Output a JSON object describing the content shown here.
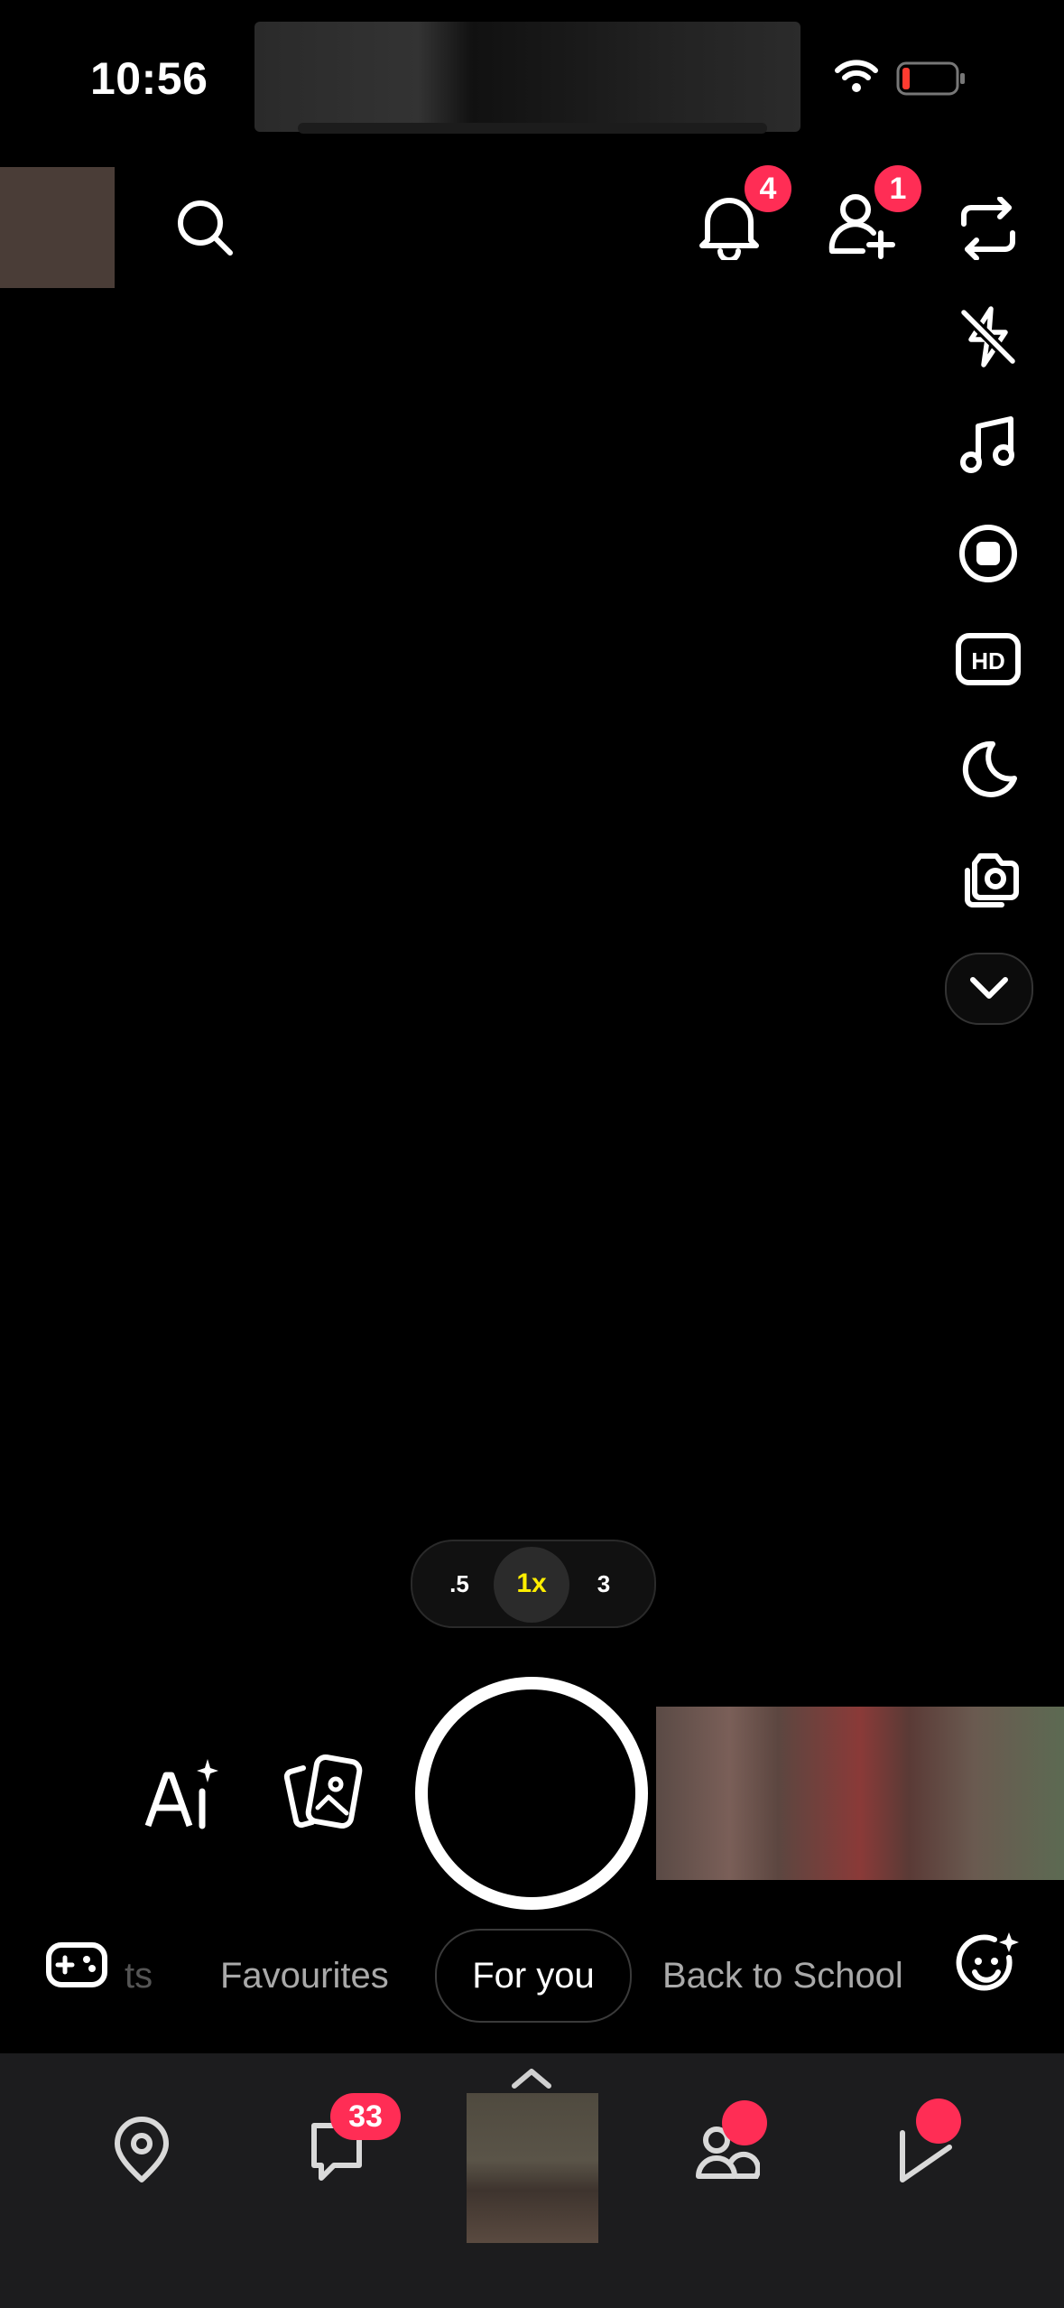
{
  "status_bar": {
    "time": "10:56"
  },
  "top_bar": {
    "notifications_count": "4",
    "friend_requests_count": "1"
  },
  "side_tools": [
    "flip-camera-icon",
    "flash-off-icon",
    "music-note-icon",
    "record-icon",
    "hd-icon",
    "night-mode-icon",
    "multi-capture-icon",
    "chevron-down-icon"
  ],
  "zoom": {
    "options": [
      ".5",
      "1x",
      "3"
    ],
    "selected": "1x"
  },
  "lens_carousel": {
    "partial_left": "ts",
    "items": [
      "Favourites",
      "For you",
      "Back to School"
    ],
    "selected": "For you"
  },
  "bottom_nav": {
    "items": [
      "map-icon",
      "chat-icon",
      "camera-thumbnail",
      "stories-icon",
      "spotlight-icon"
    ],
    "chat_count": "33"
  },
  "colors": {
    "badge": "#ff2d55",
    "zoom_selected": "#ffee00",
    "nav_bg": "#1c1c1e"
  }
}
